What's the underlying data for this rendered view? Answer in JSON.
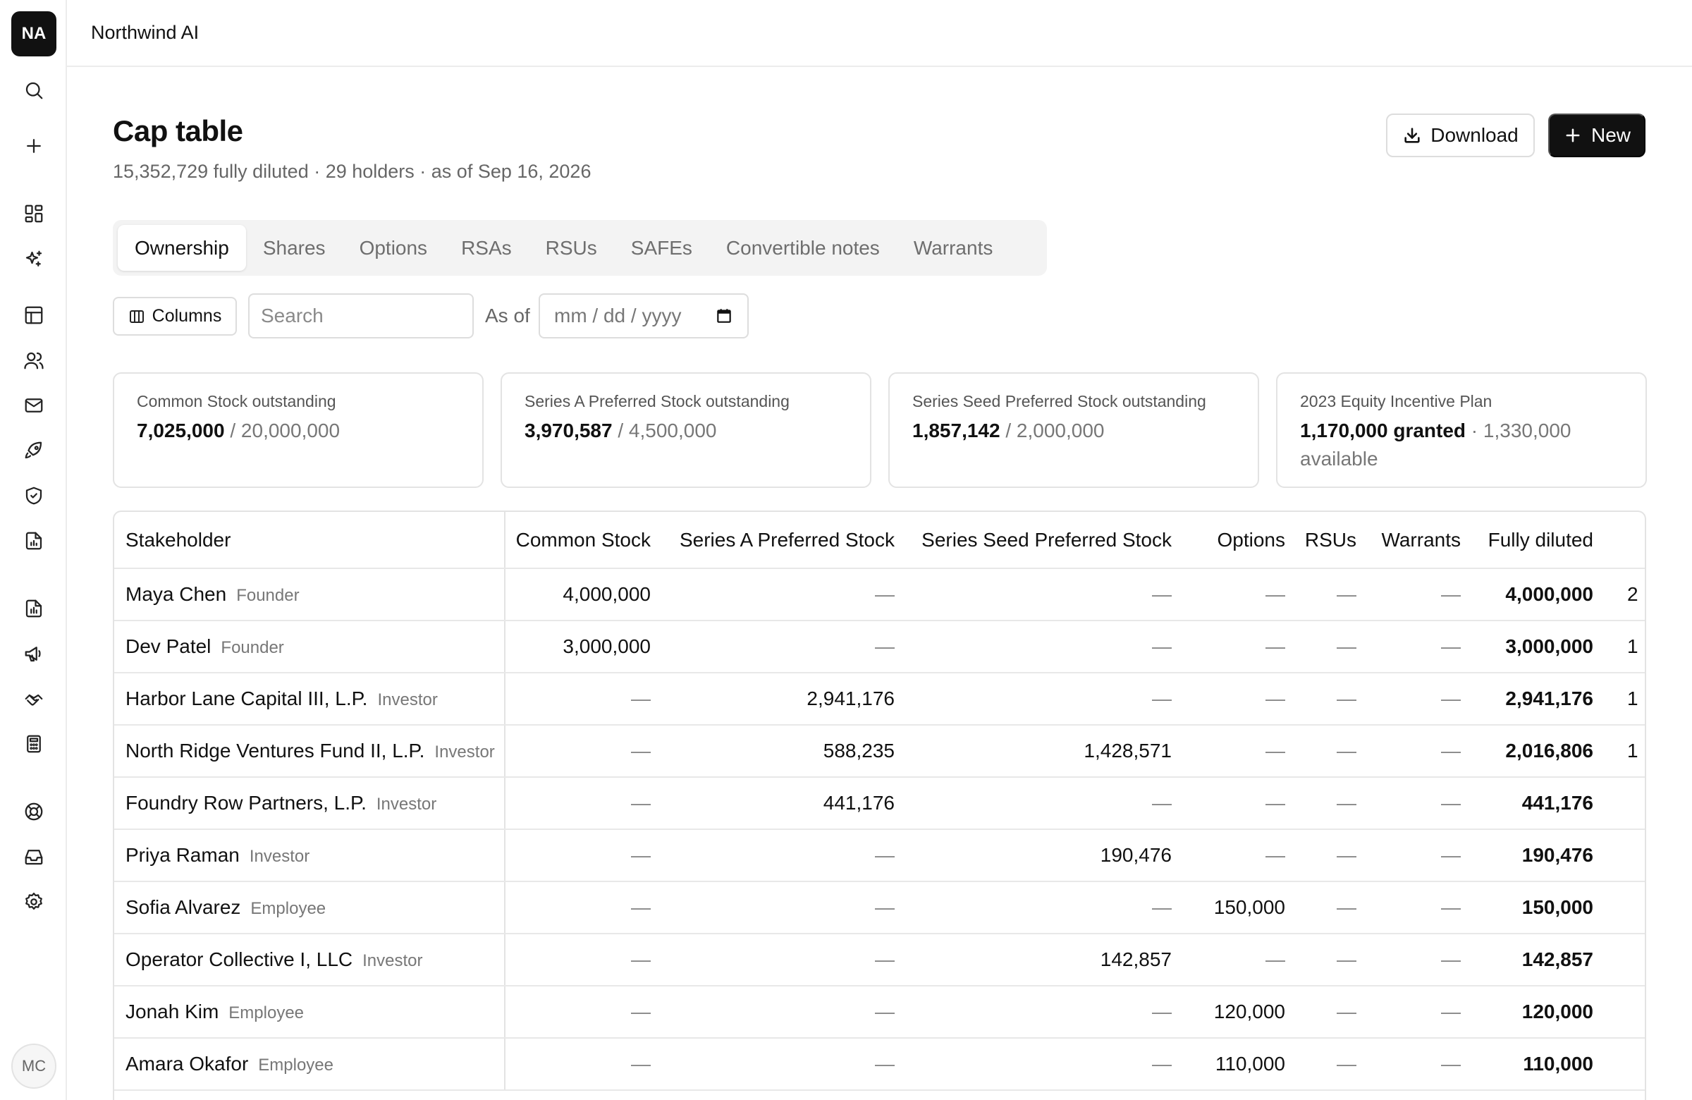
{
  "sidebar": {
    "logo_initials": "NA",
    "icons": [
      "search-icon",
      "plus-icon",
      "dashboard-icon",
      "sparkles-icon",
      "table-icon",
      "users-icon",
      "mail-icon",
      "rocket-icon",
      "shield-icon",
      "report-icon",
      "document-chart-icon",
      "megaphone-icon",
      "handshake-icon",
      "calculator-icon",
      "lifebuoy-icon",
      "inbox-icon",
      "gear-icon"
    ],
    "user_initials": "MC"
  },
  "topbar": {
    "org_name": "Northwind AI"
  },
  "header": {
    "title": "Cap table",
    "subtitle": "15,352,729 fully diluted · 29 holders · as of Sep 16, 2026",
    "download_label": "Download",
    "new_label": "New"
  },
  "tabs": [
    "Ownership",
    "Shares",
    "Options",
    "RSAs",
    "RSUs",
    "SAFEs",
    "Convertible notes",
    "Warrants"
  ],
  "toolbar": {
    "columns_label": "Columns",
    "search_placeholder": "Search",
    "asof_label": "As of",
    "date_placeholder": "mm / dd / yyyy"
  },
  "cards": [
    {
      "label": "Common Stock outstanding",
      "value": "7,025,000",
      "sep": " / ",
      "total": "20,000,000"
    },
    {
      "label": "Series A Preferred Stock outstanding",
      "value": "3,970,587",
      "sep": " / ",
      "total": "4,500,000"
    },
    {
      "label": "Series Seed Preferred Stock outstanding",
      "value": "1,857,142",
      "sep": " / ",
      "total": "2,000,000"
    },
    {
      "label": "2023 Equity Incentive Plan",
      "value": "1,170,000 granted",
      "sep": " · ",
      "total": "1,330,000 available"
    }
  ],
  "table": {
    "columns": [
      "Stakeholder",
      "Common Stock",
      "Series A Preferred Stock",
      "Series Seed Preferred Stock",
      "Options",
      "RSUs",
      "Warrants",
      "Fully diluted"
    ],
    "rows": [
      {
        "name": "Maya Chen",
        "role": "Founder",
        "common": "4,000,000",
        "series_a": "—",
        "seed": "—",
        "options": "—",
        "rsus": "—",
        "warrants": "—",
        "fully_diluted": "4,000,000",
        "extra": "2"
      },
      {
        "name": "Dev Patel",
        "role": "Founder",
        "common": "3,000,000",
        "series_a": "—",
        "seed": "—",
        "options": "—",
        "rsus": "—",
        "warrants": "—",
        "fully_diluted": "3,000,000",
        "extra": "1"
      },
      {
        "name": "Harbor Lane Capital III, L.P.",
        "role": "Investor",
        "common": "—",
        "series_a": "2,941,176",
        "seed": "—",
        "options": "—",
        "rsus": "—",
        "warrants": "—",
        "fully_diluted": "2,941,176",
        "extra": "1"
      },
      {
        "name": "North Ridge Ventures Fund II, L.P.",
        "role": "Investor",
        "common": "—",
        "series_a": "588,235",
        "seed": "1,428,571",
        "options": "—",
        "rsus": "—",
        "warrants": "—",
        "fully_diluted": "2,016,806",
        "extra": "1"
      },
      {
        "name": "Foundry Row Partners, L.P.",
        "role": "Investor",
        "common": "—",
        "series_a": "441,176",
        "seed": "—",
        "options": "—",
        "rsus": "—",
        "warrants": "—",
        "fully_diluted": "441,176",
        "extra": ""
      },
      {
        "name": "Priya Raman",
        "role": "Investor",
        "common": "—",
        "series_a": "—",
        "seed": "190,476",
        "options": "—",
        "rsus": "—",
        "warrants": "—",
        "fully_diluted": "190,476",
        "extra": ""
      },
      {
        "name": "Sofia Alvarez",
        "role": "Employee",
        "common": "—",
        "series_a": "—",
        "seed": "—",
        "options": "150,000",
        "rsus": "—",
        "warrants": "—",
        "fully_diluted": "150,000",
        "extra": ""
      },
      {
        "name": "Operator Collective I, LLC",
        "role": "Investor",
        "common": "—",
        "series_a": "—",
        "seed": "142,857",
        "options": "—",
        "rsus": "—",
        "warrants": "—",
        "fully_diluted": "142,857",
        "extra": ""
      },
      {
        "name": "Jonah Kim",
        "role": "Employee",
        "common": "—",
        "series_a": "—",
        "seed": "—",
        "options": "120,000",
        "rsus": "—",
        "warrants": "—",
        "fully_diluted": "120,000",
        "extra": ""
      },
      {
        "name": "Amara Okafor",
        "role": "Employee",
        "common": "—",
        "series_a": "—",
        "seed": "—",
        "options": "110,000",
        "rsus": "—",
        "warrants": "—",
        "fully_diluted": "110,000",
        "extra": ""
      }
    ]
  }
}
